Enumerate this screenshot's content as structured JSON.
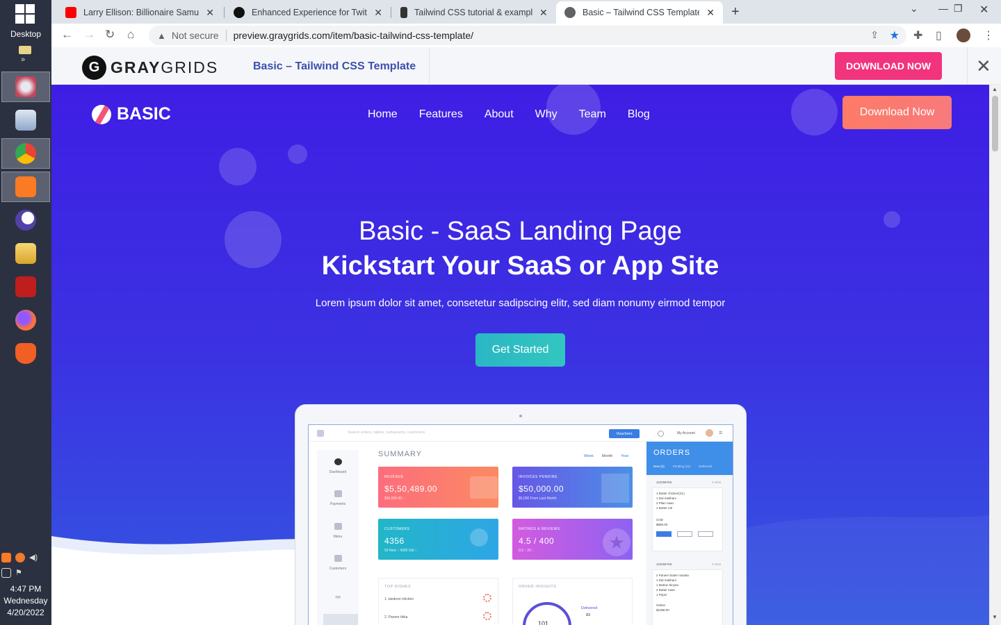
{
  "taskbar": {
    "desktop_label": "Desktop",
    "clock": {
      "time": "4:47 PM",
      "day": "Wednesday",
      "date": "4/20/2022"
    }
  },
  "browser": {
    "tabs": [
      {
        "title": "Larry Ellison: Billionaire Samurai W",
        "favicon_color": "#ff0000"
      },
      {
        "title": "Enhanced Experience for Twitter",
        "favicon_color": "#111111"
      },
      {
        "title": "Tailwind CSS tutorial & examples",
        "favicon_color": "#333333"
      },
      {
        "title": "Basic – Tailwind CSS Template | P",
        "favicon_color": "#5f6368"
      }
    ],
    "address": {
      "security": "Not secure",
      "url": "preview.graygrids.com/item/basic-tailwind-css-template/"
    }
  },
  "graygrids_bar": {
    "logo_gray": "GRAY",
    "logo_grids": "GRIDS",
    "template_title": "Basic – Tailwind CSS Template",
    "download_label": "DOWNLOAD NOW"
  },
  "site": {
    "brand": "BASIC",
    "nav": [
      "Home",
      "Features",
      "About",
      "Why",
      "Team",
      "Blog"
    ],
    "download_label": "Download Now",
    "hero_title": "Basic - SaaS Landing Page",
    "hero_subtitle": "Kickstart Your SaaS or App Site",
    "hero_text": "Lorem ipsum dolor sit amet, consetetur sadipscing elitr, sed diam nonumy eirmod tempor",
    "cta_label": "Get Started"
  },
  "dashboard": {
    "search_placeholder": "Search orders, tables, restaurants, customers",
    "vouchers_label": "Vouchers",
    "account_label": "My Account",
    "sidebar": [
      "Dashboard",
      "Payments",
      "Menu",
      "Customers",
      "TIP"
    ],
    "summary_title": "SUMMARY",
    "periods": [
      "Week",
      "Month",
      "Year"
    ],
    "cards": [
      {
        "label": "REVENUE",
        "value": "$5,50,489.00",
        "sub": "$50,000.00 ↑",
        "colors": [
          "#fd6d7d",
          "#fb8a62"
        ]
      },
      {
        "label": "INVOICES PENDING",
        "value": "$50,000.00",
        "sub": "$5,000 From Last Month",
        "colors": [
          "#6657e6",
          "#4d8fe6"
        ]
      },
      {
        "label": "CUSTOMERS",
        "value": "4356",
        "sub": "56 New ↑     4300 Old ↑",
        "colors": [
          "#22b6c7",
          "#2ea6e6"
        ]
      },
      {
        "label": "RATINGS & REVIEWS",
        "value": "4.5 / 400",
        "sub": "0.5 ↑      20 ↑",
        "colors": [
          "#d35be0",
          "#8e62f2"
        ]
      }
    ],
    "top_dishes_title": "TOP DISHES",
    "top_dishes": [
      "1. tandoori chicken",
      "2. Paneer tikka"
    ],
    "insights_title": "ORDER INSIGHTS",
    "insights_delivered_label": "Delivered",
    "insights_delivered_value": "83",
    "insights_total": "101",
    "orders_title": "ORDERS",
    "orders_tabs": [
      "New (5)",
      "Pending (11)",
      "Delivered"
    ],
    "orders": [
      {
        "id": "110296765",
        "age": "4 mins",
        "items": [
          "1 Butter chicken(XL)",
          "1 Dal makhani",
          "2 Plain naan",
          "1 Butter roti"
        ],
        "payment": "COD",
        "amount": "$889.00"
      },
      {
        "id": "110296768",
        "age": "2 mins",
        "items": [
          "2 Paneer butter masala",
          "1 Dal makhani",
          "1 Mutton biryani",
          "2 Butter naan",
          "1 Pepsi"
        ],
        "payment": "Online",
        "amount": "$1098.00"
      }
    ]
  }
}
